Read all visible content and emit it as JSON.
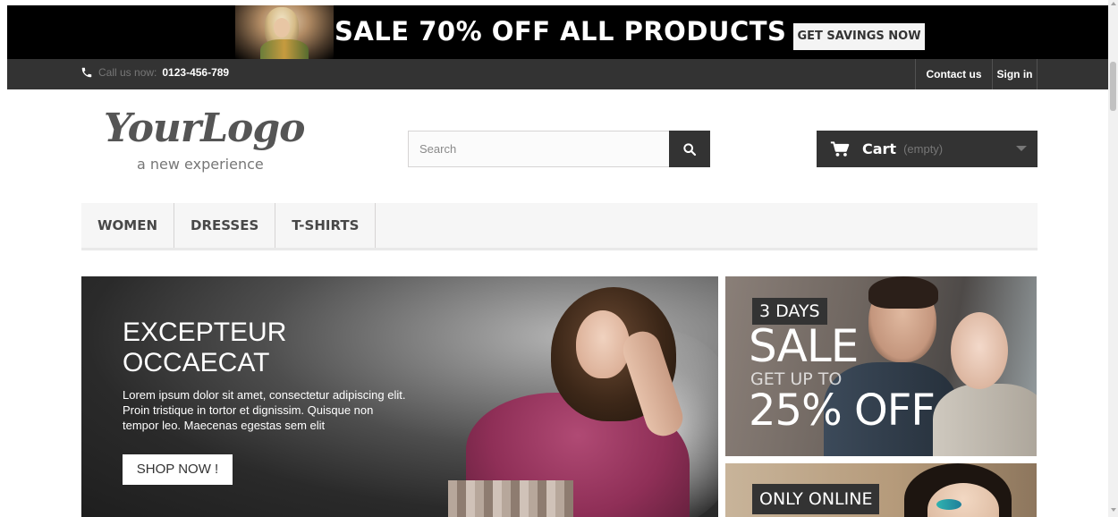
{
  "promo": {
    "title": "SALE 70% OFF ALL PRODUCTS",
    "button": "GET SAVINGS NOW"
  },
  "topbar": {
    "call_prefix": "Call us now:",
    "phone": "0123-456-789",
    "contact": "Contact us",
    "signin": "Sign in"
  },
  "logo": {
    "script": "YourLogo",
    "tagline": "a new experience"
  },
  "search": {
    "placeholder": "Search",
    "value": ""
  },
  "cart": {
    "label": "Cart",
    "status": "(empty)"
  },
  "menu": {
    "items": [
      "WOMEN",
      "DRESSES",
      "T-SHIRTS"
    ]
  },
  "hero": {
    "title": "EXCEPTEUR OCCAECAT",
    "text": "Lorem ipsum dolor sit amet, consectetur adipiscing elit. Proin tristique in tortor et dignissim. Quisque non tempor leo. Maecenas egestas sem elit",
    "button": "SHOP NOW !"
  },
  "side_banner_1": {
    "badge": "3 DAYS",
    "sale": "SALE",
    "get_up_to": "GET UP TO",
    "off": "25% OFF"
  },
  "side_banner_2": {
    "badge": "ONLY ONLINE"
  },
  "colors": {
    "dark": "#333333",
    "menu_bg": "#f6f6f6",
    "promo_bg": "#000000"
  }
}
